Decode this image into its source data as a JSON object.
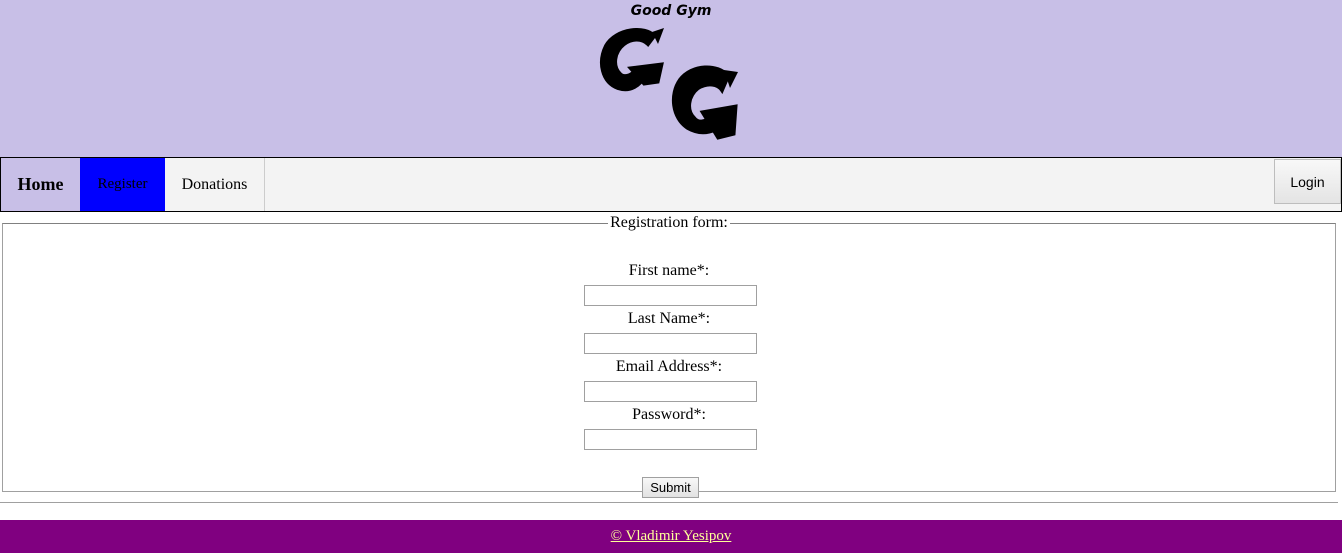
{
  "header": {
    "site_name": "Good Gym",
    "logo_text": "GG",
    "background_color": "#c8bfe7"
  },
  "nav": {
    "items": [
      {
        "label": "Home",
        "color": "#c8bfe7"
      },
      {
        "label": "Register",
        "color": "#0000ff"
      },
      {
        "label": "Donations",
        "color": "#f3f3f3"
      }
    ],
    "login_label": "Login"
  },
  "form": {
    "legend": "Registration form:",
    "fields": [
      {
        "label": "First name*:",
        "value": ""
      },
      {
        "label": "Last Name*:",
        "value": ""
      },
      {
        "label": "Email Address*:",
        "value": ""
      },
      {
        "label": "Password*:",
        "value": ""
      }
    ],
    "submit_label": "Submit"
  },
  "footer": {
    "text": "© Vladimir Yesipov",
    "background_color": "#800080",
    "link_color": "#ffff99"
  }
}
